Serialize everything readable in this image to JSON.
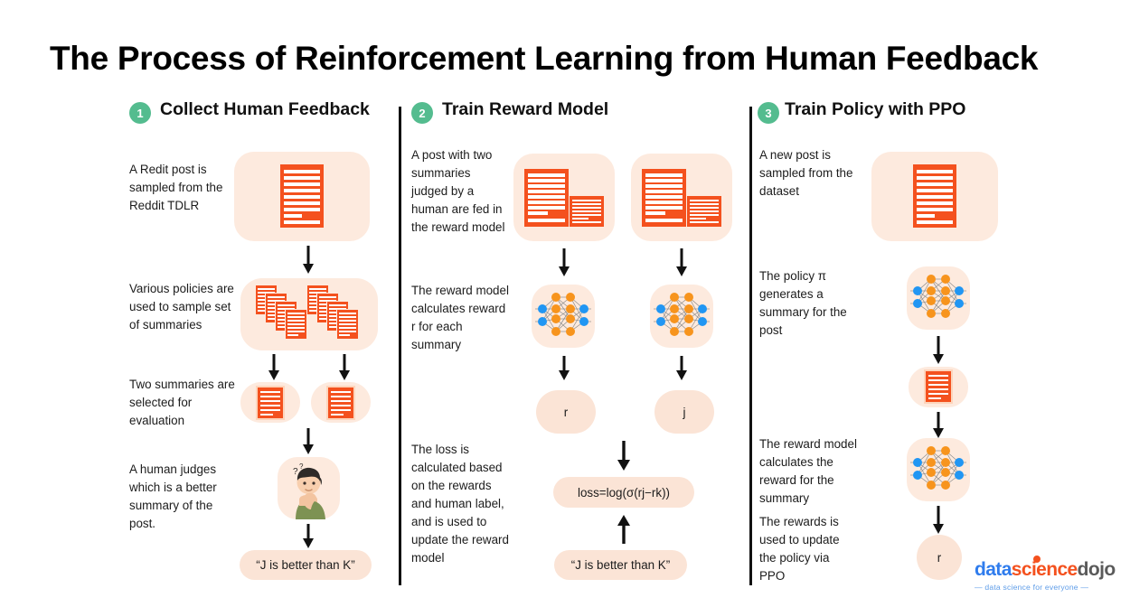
{
  "page": {
    "title": "The Process of Reinforcement Learning from Human Feedback",
    "accent_green": "#54bc8f",
    "accent_orange": "#f4511e",
    "tile_peach": "#fdeade",
    "pill_peach": "#fbe4d6",
    "node_blue": "#2196f3",
    "node_orange": "#f7941d"
  },
  "columns": [
    {
      "badge": "1",
      "title": "Collect Human Feedback",
      "captions": [
        "A Redit post is sampled from the Reddit TDLR",
        "Various policies are used to sample set of summaries",
        "Two summaries are selected for evaluation",
        "A human judges which is a better summary of the post."
      ],
      "result_label": "“J is better than K”"
    },
    {
      "badge": "2",
      "title": "Train Reward Model",
      "captions": [
        "A post with two summaries judged by a human are fed in the reward model",
        "The reward model calculates reward r for each summary",
        "The loss is calculated based on the rewards and human label, and is used to update the reward model"
      ],
      "reward_left": "r",
      "reward_right": "j",
      "loss_formula": "loss=log(σ(rj−rk))",
      "human_label": "“J is better than K”"
    },
    {
      "badge": "3",
      "title": "Train Policy with PPO",
      "captions": [
        "A new post is sampled from the dataset",
        "The policy π generates a summary for the post",
        "The reward model calculates the reward for the summary",
        "The rewards is used to update the policy via PPO"
      ],
      "reward_label": "r"
    }
  ],
  "logo": {
    "part1": "data",
    "part2": "science",
    "part3": "dojo",
    "tagline": "—  data science for everyone  —"
  }
}
